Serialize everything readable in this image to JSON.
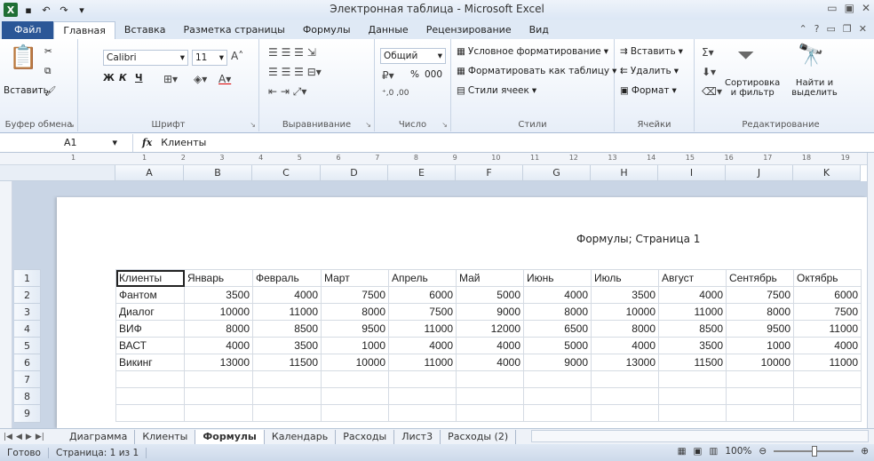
{
  "window": {
    "title": "Электронная таблица - Microsoft Excel",
    "app_icon": "X",
    "controls": [
      "▭",
      "▣",
      "✕"
    ]
  },
  "tabs": {
    "file": "Файл",
    "items": [
      "Главная",
      "Вставка",
      "Разметка страницы",
      "Формулы",
      "Данные",
      "Рецензирование",
      "Вид"
    ],
    "active": "Главная"
  },
  "ribbon": {
    "clipboard": {
      "paste": "Вставить",
      "label": "Буфер обмена"
    },
    "font": {
      "name": "Calibri",
      "size": "11",
      "label": "Шрифт",
      "bold": "Ж",
      "italic": "К",
      "underline": "Ч"
    },
    "alignment": {
      "label": "Выравнивание"
    },
    "number": {
      "format": "Общий",
      "percent": "%",
      "thousands": "000",
      "label": "Число"
    },
    "styles": {
      "conditional": "Условное форматирование",
      "as_table": "Форматировать как таблицу",
      "cell_styles": "Стили ячеек",
      "label": "Стили"
    },
    "cells": {
      "insert": "Вставить",
      "delete": "Удалить",
      "format": "Формат",
      "label": "Ячейки"
    },
    "editing": {
      "sort": "Сортировка и фильтр",
      "find": "Найти и выделить",
      "label": "Редактирование"
    }
  },
  "formula_bar": {
    "name_box": "A1",
    "fx": "fx",
    "content": "Клиенты"
  },
  "ruler_marks": [
    "1",
    "1",
    "2",
    "3",
    "4",
    "5",
    "6",
    "7",
    "8",
    "9",
    "10",
    "11",
    "12",
    "13",
    "14",
    "15",
    "16",
    "17",
    "18",
    "19"
  ],
  "columns": [
    "A",
    "B",
    "C",
    "D",
    "E",
    "F",
    "G",
    "H",
    "I",
    "J",
    "K"
  ],
  "page_header": "Формулы; Страница 1",
  "rows": [
    {
      "n": "1",
      "cells": [
        "Клиенты",
        "Январь",
        "Февраль",
        "Март",
        "Апрель",
        "Май",
        "Июнь",
        "Июль",
        "Август",
        "Сентябрь",
        "Октябрь"
      ]
    },
    {
      "n": "2",
      "cells": [
        "Фантом",
        "3500",
        "4000",
        "7500",
        "6000",
        "5000",
        "4000",
        "3500",
        "4000",
        "7500",
        "6000"
      ]
    },
    {
      "n": "3",
      "cells": [
        "Диалог",
        "10000",
        "11000",
        "8000",
        "7500",
        "9000",
        "8000",
        "10000",
        "11000",
        "8000",
        "7500"
      ]
    },
    {
      "n": "4",
      "cells": [
        "ВИФ",
        "8000",
        "8500",
        "9500",
        "11000",
        "12000",
        "6500",
        "8000",
        "8500",
        "9500",
        "11000"
      ]
    },
    {
      "n": "5",
      "cells": [
        "ВАСТ",
        "4000",
        "3500",
        "1000",
        "4000",
        "4000",
        "5000",
        "4000",
        "3500",
        "1000",
        "4000"
      ]
    },
    {
      "n": "6",
      "cells": [
        "Викинг",
        "13000",
        "11500",
        "10000",
        "11000",
        "4000",
        "9000",
        "13000",
        "11500",
        "10000",
        "11000"
      ]
    },
    {
      "n": "7",
      "cells": [
        "",
        "",
        "",
        "",
        "",
        "",
        "",
        "",
        "",
        "",
        ""
      ]
    },
    {
      "n": "8",
      "cells": [
        "",
        "",
        "",
        "",
        "",
        "",
        "",
        "",
        "",
        "",
        ""
      ]
    },
    {
      "n": "9",
      "cells": [
        "",
        "",
        "",
        "",
        "",
        "",
        "",
        "",
        "",
        "",
        ""
      ]
    }
  ],
  "sheet_tabs": [
    "Диаграмма",
    "Клиенты",
    "Формулы",
    "Календарь",
    "Расходы",
    "Лист3",
    "Расходы (2)"
  ],
  "active_sheet": "Формулы",
  "status": {
    "ready": "Готово",
    "page": "Страница: 1 из 1",
    "zoom": "100%"
  }
}
